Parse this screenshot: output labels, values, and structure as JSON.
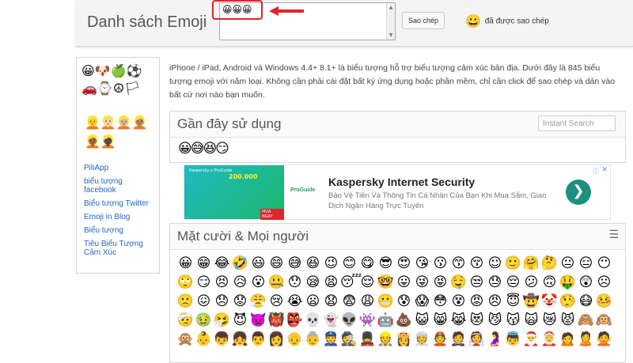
{
  "header": {
    "title": "Danh sách Emoji",
    "textbox_value": "😀😀😀",
    "scroll_up": "▲",
    "scroll_down": "▼",
    "copy_button": "Sao chép",
    "status_emoji": "😀",
    "status_text": "đã được sao chép",
    "arrow_color": "#e0242d"
  },
  "sidebar": {
    "category_icons": "😀🐶🍏⚽🚗⌚☮🏳",
    "skin_tones": "👱👱🏻👱🏼👱🏽👱🏾👱🏿",
    "links": [
      "PiliApp",
      "biểu tượng facebook",
      "Biểu tượng Twitter",
      "Emoji in Blog",
      "Biểu tượng",
      "Tiêu Biểu Tượng Cảm Xúc"
    ]
  },
  "description": "iPhone / iPad, Android và Windows 4.4+ 8.1+ là biểu tượng hỗ trợ biểu tượng cảm xúc bản địa. Dưới đây là 845 biểu tượng emoji với năm loại. Không cần phải cài đặt bất kỳ ứng dụng hoặc phần mềm, chỉ cần click để sao chép và dán vào bất cứ nơi nào bạn muốn.",
  "recent": {
    "title": "Gần đây sử dụng",
    "search_placeholder": "Instant Search",
    "emojis": "😀😅😆😏"
  },
  "ad": {
    "image_small_text": "Kaspersky x ProGuide",
    "image_amount": "200.000",
    "image_button": "MUA NGAY",
    "brand": "ProGuide",
    "title": "Kaspersky Internet Security",
    "subtitle": "Bảo Vệ Tiền Và Thông Tin Cá Nhân Của Bạn Khi Mua Sắm, Giao Dịch Ngân Hàng Trực Tuyến",
    "go": "❯",
    "info": "ⓘ",
    "close": "✕"
  },
  "smileys": {
    "title": "Mặt cười & Mọi người",
    "menu": "☰",
    "emojis": [
      "😀",
      "😁",
      "😂",
      "🤣",
      "😃",
      "😄",
      "😅",
      "😆",
      "😉",
      "😊",
      "😋",
      "😎",
      "😍",
      "😘",
      "😗",
      "😙",
      "😚",
      "☺",
      "🙂",
      "🤗",
      "🤔",
      "😐",
      "😑",
      "😶",
      "🙄",
      "😏",
      "😣",
      "😥",
      "😮",
      "🤐",
      "😯",
      "😪",
      "😫",
      "😴",
      "😌",
      "🤓",
      "😛",
      "😜",
      "😝",
      "🤤",
      "😒",
      "😓",
      "😔",
      "😕",
      "🙃",
      "🤑",
      "😲",
      "☹",
      "🙁",
      "😖",
      "😞",
      "😟",
      "😤",
      "😢",
      "😭",
      "😦",
      "😧",
      "😨",
      "😩",
      "😬",
      "😰",
      "😱",
      "😳",
      "😵",
      "😡",
      "😠",
      "😇",
      "🤠",
      "🤡",
      "🤥",
      "😷",
      "🤒",
      "🤕",
      "🤢",
      "🤧",
      "😈",
      "👿",
      "👹",
      "👺",
      "💀",
      "👻",
      "👽",
      "👾",
      "🤖",
      "💩",
      "😺",
      "😸",
      "😹",
      "😻",
      "😼",
      "😽",
      "🙀",
      "😿",
      "😾",
      "🙈",
      "🙉",
      "🙊",
      "👶",
      "👦",
      "👧",
      "👨",
      "👩",
      "👴",
      "👵",
      "👮",
      "🕵",
      "💂",
      "👷",
      "👸",
      "👳",
      "👲",
      "🤵",
      "👰",
      "🤰",
      "👼",
      "🎅",
      "🤶",
      "🙍",
      "🙎",
      "🙅"
    ]
  }
}
